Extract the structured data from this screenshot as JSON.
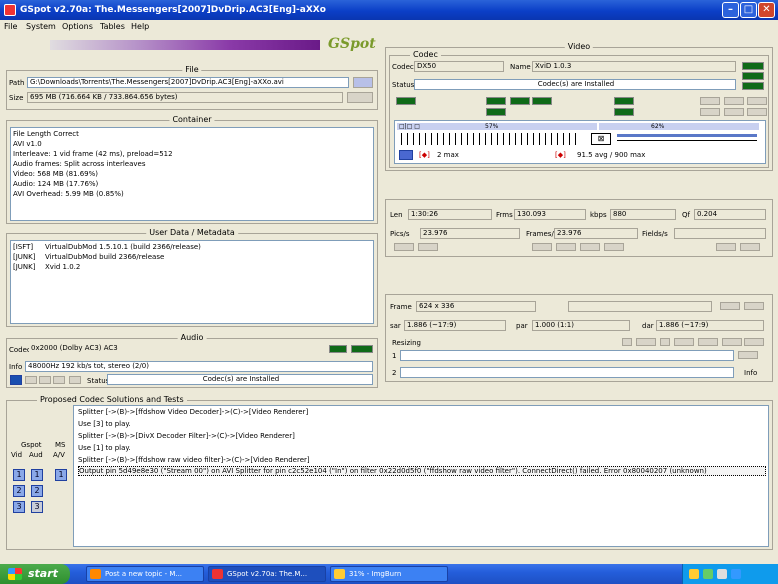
{
  "window": {
    "title": "GSpot v2.70a: The.Messengers[2007]DvDrip.AC3[Eng]-aXXo"
  },
  "menu": [
    "File",
    "System",
    "Options",
    "Tables",
    "Help"
  ],
  "logo": "GSpot",
  "file": {
    "legend": "File",
    "path_label": "Path",
    "path": "G:\\Downloads\\Torrents\\The.Messengers[2007]DvDrip.AC3[Eng]-aXXo.avi",
    "size_label": "Size",
    "size": "695 MB (716.664 KB / 733.864.656 bytes)"
  },
  "container": {
    "legend": "Container",
    "lines": [
      "File Length Correct",
      "AVI v1.0",
      "Interleave: 1 vid frame (42 ms), preload=512",
      "Audio frames: Split across interleaves",
      "Video: 568 MB (81.69%)",
      "Audio: 124 MB (17.76%)",
      "AVI Overhead: 5.99 MB (0.85%)"
    ]
  },
  "metadata": {
    "legend": "User Data / Metadata",
    "rows": [
      {
        "key": "[ISFT]",
        "value": "VirtualDubMod 1.5.10.1 (build 2366/release)"
      },
      {
        "key": "[JUNK]",
        "value": "VirtualDubMod build 2366/release"
      },
      {
        "key": "[JUNK]",
        "value": "Xvid 1.0.2"
      }
    ]
  },
  "audio": {
    "legend": "Audio",
    "codec_label": "Codec",
    "codec": "0x2000 (Dolby AC3) AC3",
    "info_label": "Info",
    "info": "48000Hz 192 kb/s tot, stereo (2/0)",
    "status_label": "Status",
    "status": "Codec(s) are Installed"
  },
  "video": {
    "legend": "Video",
    "codec_sub": "Codec",
    "codec_label": "Codec",
    "codec": "DX50",
    "name_label": "Name",
    "name": "XviD 1.0.3",
    "status_label": "Status",
    "status": "Codec(s) are Installed",
    "bar_left_pct": "57%",
    "bar_right_pct": "62%",
    "frames_text": "2 max",
    "avg_text": "91.5 avg / 900 max"
  },
  "timing": {
    "len_label": "Len",
    "len": "1:30:26",
    "frms_label": "Frms",
    "frms": "130.093",
    "kbps_label": "kbps",
    "kbps": "880",
    "qf_label": "Qf",
    "qf": "0.204",
    "pics_label": "Pics/s",
    "pics": "23.976",
    "frames_label": "Frames/s",
    "frames": "23.976",
    "fields_label": "Fields/s",
    "fields": ""
  },
  "resolution": {
    "frame_label": "Frame",
    "frame": "624 x 336",
    "sar_label": "sar",
    "sar": "1.886 (~17:9)",
    "par_label": "par",
    "par": "1.000 (1:1)",
    "dar_label": "dar",
    "dar": "1.886 (~17:9)",
    "resizing_label": "Resizing",
    "row1_num": "1",
    "row2_num": "2",
    "info_label": "Info"
  },
  "solutions": {
    "legend": "Proposed Codec Solutions and Tests",
    "left_head": "Gspot",
    "vid_label": "Vid",
    "aud_label": "Aud",
    "ms_label": "MS",
    "av_label": "A/V",
    "vid_btns": [
      "1",
      "2",
      "3"
    ],
    "aud_btns": [
      "1",
      "2",
      "3"
    ],
    "ms_btns": [
      "1"
    ],
    "lines": [
      "Splitter [->(B)->[ffdshow Video Decoder]->(C)->[Video Renderer]",
      "Use [3] to play.",
      "Splitter [->(B)->[DivX Decoder Filter]->(C)->[Video Renderer]",
      "Use [1] to play.",
      "Splitter [->(B)->[ffdshow raw video filter]->(C)->[Video Renderer]",
      "Output pin 5d49e8e30 (\"Stream 00\") on AVI Splitter for pin c2c52e104 (\"In\") on filter 0x22d0d5f0 (\"ffdshow raw video filter\"). ConnectDirect() failed. Error 0x80040207 (unknown)"
    ]
  },
  "taskbar": {
    "start": "start",
    "tasks": [
      "Post a new topic - M...",
      "GSpot v2.70a: The.M...",
      "31% - ImgBurn"
    ],
    "time": ""
  },
  "colors": {
    "title_blue": "#0b3fc7",
    "start_green": "#2e8f2e",
    "ok_green": "#0f6a18"
  }
}
